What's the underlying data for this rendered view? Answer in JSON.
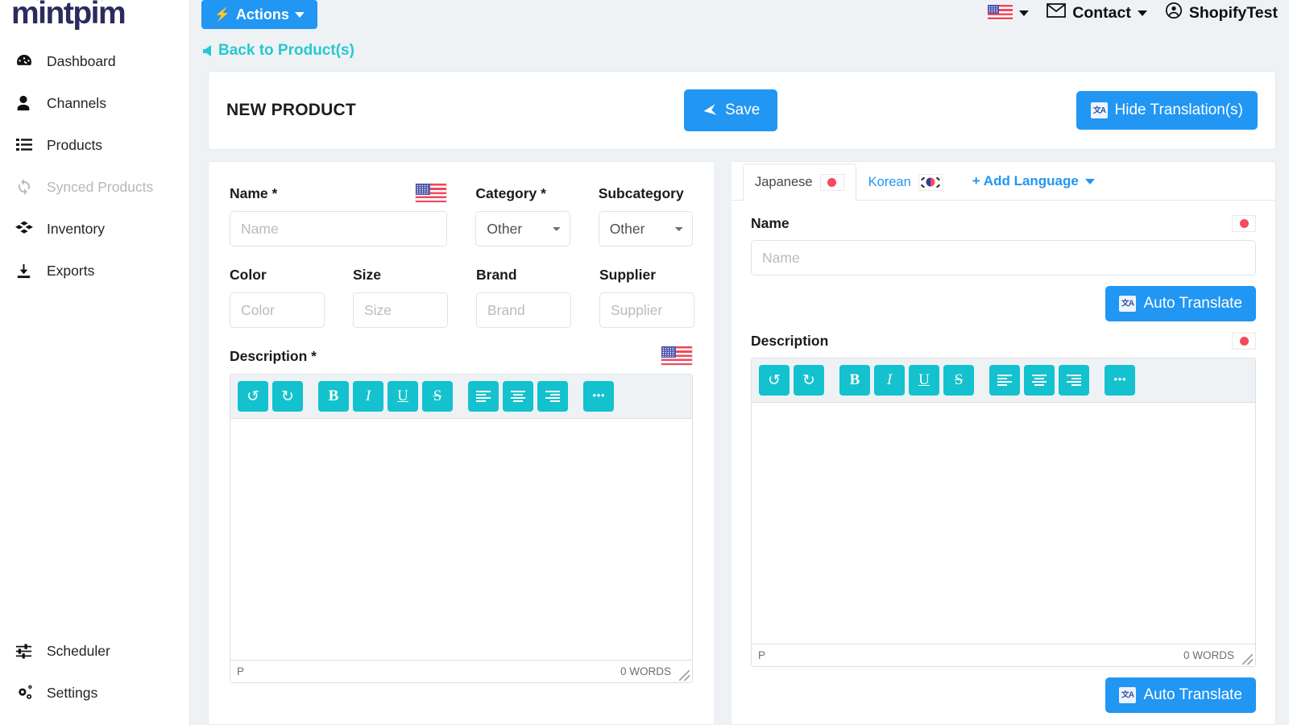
{
  "brand": {
    "name": "mintpim"
  },
  "sidebar": {
    "items": [
      {
        "label": "Dashboard",
        "icon": "dashboard-icon",
        "disabled": false
      },
      {
        "label": "Channels",
        "icon": "user-icon",
        "disabled": false
      },
      {
        "label": "Products",
        "icon": "list-icon",
        "disabled": false
      },
      {
        "label": "Synced Products",
        "icon": "sync-icon",
        "disabled": true
      },
      {
        "label": "Inventory",
        "icon": "boxes-icon",
        "disabled": false
      },
      {
        "label": "Exports",
        "icon": "download-icon",
        "disabled": false
      }
    ],
    "bottom_items": [
      {
        "label": "Scheduler",
        "icon": "sliders-icon"
      },
      {
        "label": "Settings",
        "icon": "gears-icon"
      }
    ]
  },
  "topbar": {
    "actions_label": "Actions",
    "language_flag": "us-flag-icon",
    "contact_label": "Contact",
    "account_label": "ShopifyTest"
  },
  "back_link": {
    "label": "Back to Product(s)"
  },
  "card": {
    "title": "NEW PRODUCT",
    "save_label": "Save",
    "hide_translations_label": "Hide Translation(s)"
  },
  "form": {
    "name": {
      "label": "Name *",
      "placeholder": "Name",
      "value": "",
      "flag": "us-flag-icon"
    },
    "category": {
      "label": "Category *",
      "selected": "Other",
      "options": [
        "Other"
      ]
    },
    "subcategory": {
      "label": "Subcategory",
      "selected": "Other",
      "options": [
        "Other"
      ]
    },
    "color": {
      "label": "Color",
      "placeholder": "Color",
      "value": ""
    },
    "size": {
      "label": "Size",
      "placeholder": "Size",
      "value": ""
    },
    "brand": {
      "label": "Brand",
      "placeholder": "Brand",
      "value": ""
    },
    "supplier": {
      "label": "Supplier",
      "placeholder": "Supplier",
      "value": ""
    },
    "description": {
      "label": "Description *",
      "flag": "us-flag-icon",
      "content": "",
      "status_tag": "P",
      "word_count": "0 WORDS"
    }
  },
  "editor_toolbar": {
    "buttons": [
      {
        "name": "undo-icon",
        "glyph": "↺"
      },
      {
        "name": "redo-icon",
        "glyph": "↻"
      },
      {
        "name": "bold-icon",
        "glyph": "B"
      },
      {
        "name": "italic-icon",
        "glyph": "I"
      },
      {
        "name": "underline-icon",
        "glyph": "U"
      },
      {
        "name": "strikethrough-icon",
        "glyph": "S"
      },
      {
        "name": "align-left-icon",
        "glyph": "≡"
      },
      {
        "name": "align-center-icon",
        "glyph": "≡"
      },
      {
        "name": "align-right-icon",
        "glyph": "≡"
      },
      {
        "name": "more-options-icon",
        "glyph": "•••"
      }
    ]
  },
  "translations": {
    "tabs": [
      {
        "label": "Japanese",
        "flag": "japan-flag-icon",
        "active": true
      },
      {
        "label": "Korean",
        "flag": "korea-flag-icon",
        "active": false
      }
    ],
    "add_language_label": "+ Add Language",
    "name": {
      "label": "Name",
      "placeholder": "Name",
      "value": "",
      "flag": "japan-flag-icon",
      "auto_translate_label": "Auto Translate"
    },
    "description": {
      "label": "Description",
      "flag": "japan-flag-icon",
      "content": "",
      "status_tag": "P",
      "word_count": "0 WORDS",
      "auto_translate_label": "Auto Translate"
    }
  },
  "colors": {
    "primary_blue": "#2196f3",
    "teal": "#13c2ce",
    "brand_navy": "#2b2b5e",
    "brand_accent": "#20c9a6",
    "page_bg": "#eef2f5"
  }
}
